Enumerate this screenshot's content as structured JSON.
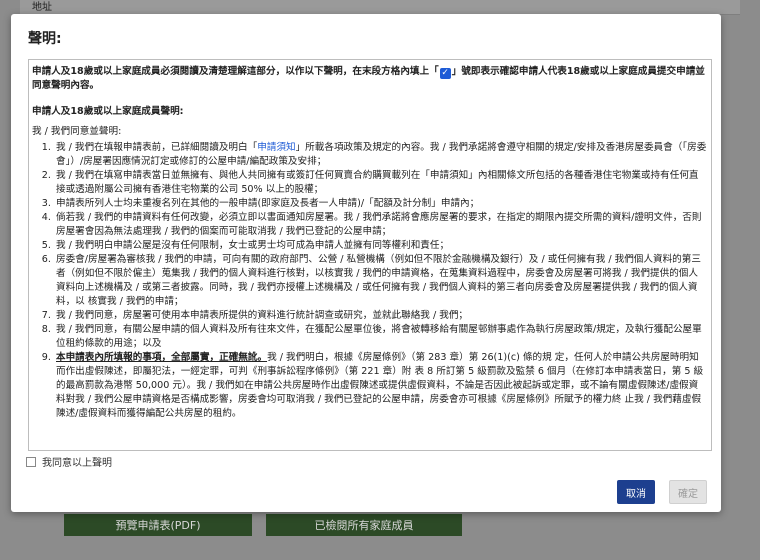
{
  "background": {
    "top_label": "地址",
    "preview_pdf_label": "預覽申請表(PDF)",
    "checked_members_label": "已檢閱所有家庭成員"
  },
  "modal": {
    "title": "聲明:",
    "intro_before_checkbox": "申請人及18歲或以上家庭成員必須閱讀及清楚理解這部分，以作以下聲明，在末段方格內填上「",
    "intro_after_checkbox": "」號即表示確認申請人代表18歲或以上家庭成員提交申請並同意聲明內容。",
    "section_heading": "申請人及18歲或以上家庭成員聲明:",
    "agree_heading": "我 / 我們同意並聲明:",
    "items": [
      {
        "pre": "我 / 我們在填報申請表前，已詳細閱讀及明白「",
        "link": "申請須知",
        "post": "」所載各項政策及規定的內容。我 / 我們承諾將會遵守相關的規定/安排及香港房屋委員會（「房委會」）/房屋署因應情況訂定或修訂的公屋申請/編配政策及安排；"
      },
      {
        "text": "我 / 我們在填寫申請表當日並無擁有、與他人共同擁有或簽訂任何買賣合約購買載列在「申請須知」內相關條文所包括的各種香港住宅物業或持有任何直接或透過附屬公司擁有香港住宅物業的公司 50% 以上的股權；"
      },
      {
        "text": "申請表所列人士均未重複名列在其他的一般申請(即家庭及長者一人申請)/「配額及計分制」申請內；"
      },
      {
        "text": "倘若我 / 我們的申請資料有任何改變，必須立即以書面通知房屋署。我 / 我們承諾將會應房屋署的要求，在指定的期限內提交所需的資料/證明文件，否則房屋署會因為無法處理我 / 我們的個案而可能取消我 / 我們已登記的公屋申請；"
      },
      {
        "text": "我 / 我們明白申請公屋是沒有任何限制，女士或男士均可成為申請人並擁有同等權利和責任；"
      },
      {
        "text": "房委會/房屋署為審核我 / 我們的申請，可向有關的政府部門、公營 / 私營機構（例如但不限於金融機構及銀行）及 / 或任何擁有我 / 我們個人資料的第三者（例如但不限於僱主）蒐集我 / 我們的個人資料進行核對，以核實我 / 我們的申請資格，在蒐集資料過程中，房委會及房屋署可將我 / 我們提供的個人資料向上述機構及 / 或第三者披露。同時，我 / 我們亦授權上述機構及 / 或任何擁有我 / 我們個人資料的第三者向房委會及房屋署提供我 / 我們的個人資料，以 核實我 / 我們的申請；"
      },
      {
        "text": "我 / 我們同意，房屋署可使用本申請表所提供的資料進行統計調查或研究，並就此聯絡我 / 我們；"
      },
      {
        "text": "我 / 我們同意，有關公屋申請的個人資料及所有往來文件，在獲配公屋單位後，將會被轉移給有關屋邨辦事處作為執行房屋政策/規定，及執行獲配公屋單位租約條款的用途；以及"
      },
      {
        "bold": "本申請表內所填報的事項，全部屬實，正確無訛。",
        "text": "我 / 我們明白，根據《房屋條例》（第 283 章）第 26(1)(c) 條的規 定，任何人於申請公共房屋時明知而作出虛假陳述，即屬犯法，一經定罪，可判《刑事訴訟程序條例》（第 221 章）附 表 8 所訂第 5 級罰款及監禁 6 個月（在修訂本申請表當日，第 5 級的最高罰款為港幣 50,000 元）。我 / 我們如在申請公共房屋時作出虛假陳述或提供虛假資料，不論是否因此被起訴或定罪，或不論有關虛假陳述/虛假資料對我 / 我們公屋申請資格是否構成影響，房委會均可取消我 / 我們已登記的公屋申請，房委會亦可根據《房屋條例》所賦予的權力終 止我 / 我們藉虛假陳述/虛假資料而獲得編配公共房屋的租約。"
      }
    ],
    "agree_label": "我同意以上聲明",
    "cancel_label": "取消",
    "confirm_label": "確定",
    "checkmark": "✓"
  },
  "colors": {
    "primary": "#1d3f8f",
    "link": "#1e5bd6",
    "disabled": "#e3e3e3",
    "background_button": "#2c4a26"
  }
}
